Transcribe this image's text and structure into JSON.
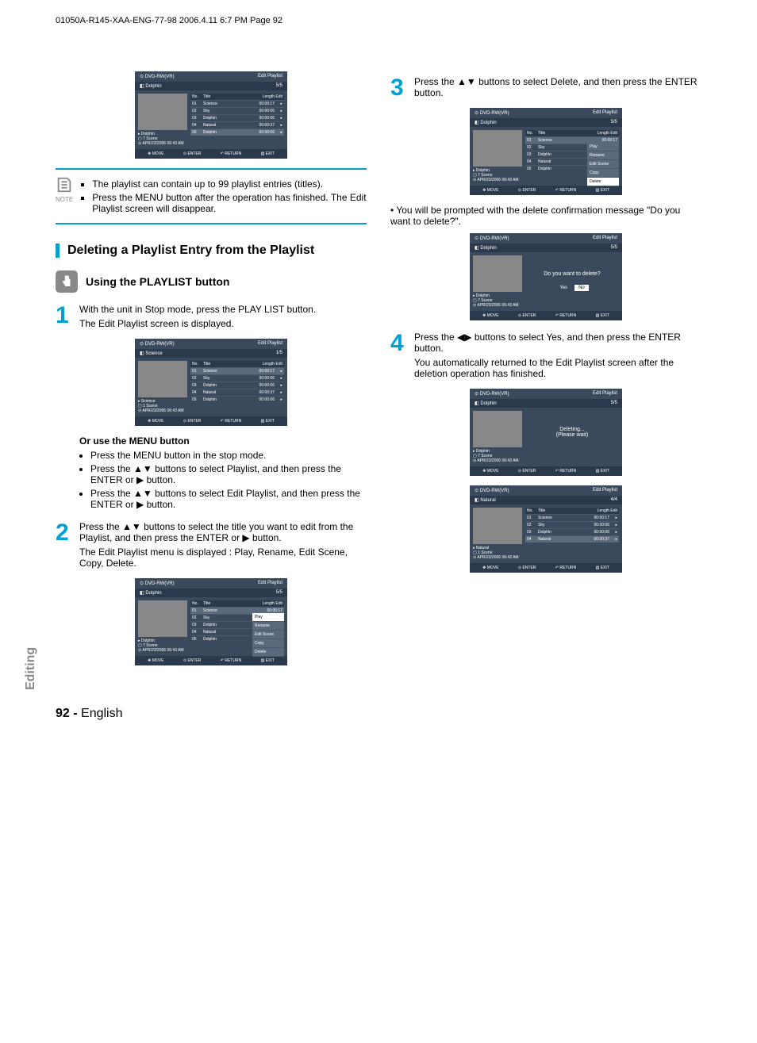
{
  "header_line": "01050A-R145-XAA-ENG-77-98  2006.4.11  6:7 PM  Page 92",
  "side_label": "Editing",
  "note_label": "NOTE",
  "note_items": [
    "The playlist can contain up to 99 playlist entries (titles).",
    "Press the MENU button after the operation has finished. The Edit Playlist screen will disappear."
  ],
  "section_title": "Deleting a Playlist Entry from the Playlist",
  "subsection_title": "Using the PLAYLIST button",
  "steps": {
    "s1": {
      "num": "1",
      "lines": [
        "With the unit in Stop mode, press the PLAY LIST button.",
        "The Edit Playlist screen is displayed."
      ]
    },
    "s2": {
      "num": "2",
      "lines": [
        "Press the ▲▼ buttons to select the title you want to edit from the Playlist, and then press the ENTER or ▶ button.",
        "The Edit Playlist menu is displayed : Play, Rename, Edit Scene, Copy, Delete."
      ]
    },
    "s3": {
      "num": "3",
      "lines": [
        "Press the ▲▼ buttons to select Delete, and then press the ENTER button."
      ]
    },
    "s4": {
      "num": "4",
      "lines": [
        "Press the ◀▶ buttons to select Yes, and then press the ENTER button.",
        "You automatically returned to the Edit Playlist screen after the deletion operation has finished."
      ]
    }
  },
  "delete_prompt": "• You will be prompted with the delete confirmation message \"Do you want to delete?\".",
  "or_menu_title": "Or use the MENU button",
  "or_menu_items": [
    "Press the MENU button in the stop mode.",
    "Press the ▲▼ buttons to select Playlist, and then press the ENTER or ▶ button.",
    "Press the ▲▼ buttons to select Edit Playlist, and then press the ENTER or ▶ button."
  ],
  "osd_common": {
    "disc": "DVD-RW(VR)",
    "mode": "Edit Playlist",
    "headers": {
      "no": "No.",
      "title": "Title",
      "length": "Length",
      "edit": "Edit"
    },
    "footer": {
      "move": "MOVE",
      "enter": "ENTER",
      "return": "RETURN",
      "exit": "EXIT"
    },
    "date": "APR/23/2006 06:43 AM"
  },
  "osd_dolphin": {
    "title": "Dolphin",
    "counter": "5/5",
    "name": "Dolphin",
    "scene": "7 Scene",
    "rows": [
      {
        "no": "01",
        "title": "Science",
        "len": "00:00:17"
      },
      {
        "no": "02",
        "title": "Sky",
        "len": "00:00:06"
      },
      {
        "no": "03",
        "title": "Dolphin",
        "len": "00:00:06"
      },
      {
        "no": "04",
        "title": "Natural",
        "len": "00:00:37"
      },
      {
        "no": "05",
        "title": "Dolphin",
        "len": "00:00:06"
      }
    ]
  },
  "osd_science": {
    "title": "Science",
    "counter": "1/5",
    "name": "Science",
    "scene": "1 Scene",
    "rows": [
      {
        "no": "01",
        "title": "Science",
        "len": "00:00:17"
      },
      {
        "no": "02",
        "title": "Sky",
        "len": "00:00:06"
      },
      {
        "no": "03",
        "title": "Dolphin",
        "len": "00:00:06"
      },
      {
        "no": "04",
        "title": "Natural",
        "len": "00:00:37"
      },
      {
        "no": "05",
        "title": "Dolphin",
        "len": "00:00:06"
      }
    ]
  },
  "osd_natural": {
    "title": "Natural",
    "counter": "4/4",
    "name": "Natural",
    "scene": "1 Scene",
    "rows": [
      {
        "no": "01",
        "title": "Science",
        "len": "00:00:17"
      },
      {
        "no": "02",
        "title": "Sky",
        "len": "00:00:06"
      },
      {
        "no": "03",
        "title": "Dolphin",
        "len": "00:00:06"
      },
      {
        "no": "04",
        "title": "Natural",
        "len": "00:00:37"
      }
    ]
  },
  "popup_menu": [
    "Play",
    "Rename",
    "Edit Scene",
    "Copy",
    "Delete"
  ],
  "confirm_msg": "Do you want to delete?",
  "confirm_yes": "Yes",
  "confirm_no": "No",
  "deleting_msg1": "Deleting...",
  "deleting_msg2": "(Please wait)",
  "footer_page": "92 -",
  "footer_lang": "English"
}
